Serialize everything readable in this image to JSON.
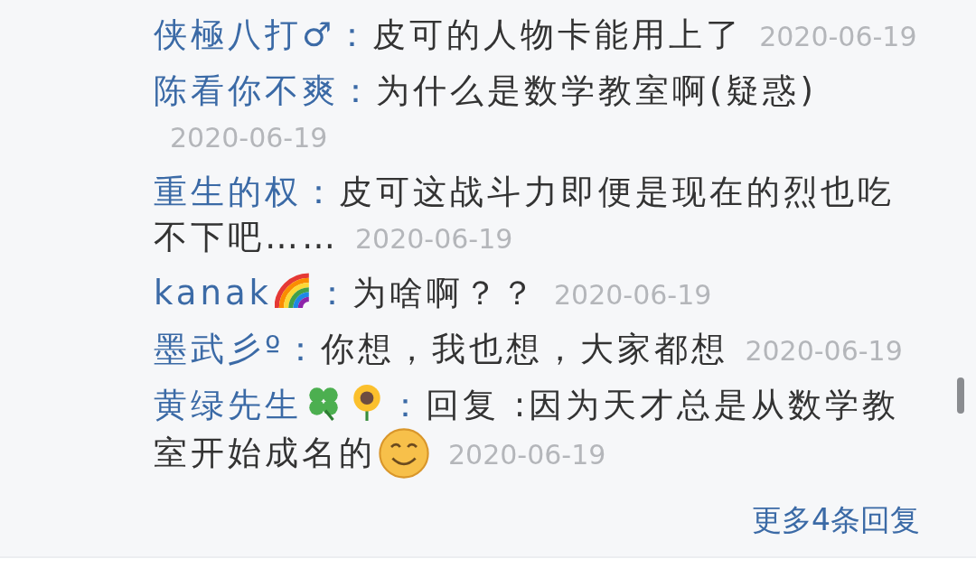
{
  "comments": [
    {
      "user": "侠極八打♂",
      "separator": "：",
      "content": "皮可的人物卡能用上了",
      "date": "2020-06-19"
    },
    {
      "user": "陈看你不爽",
      "separator": "：",
      "content": "为什么是数学教室啊(疑惑)",
      "date": "2020-06-19"
    },
    {
      "user": "重生的权",
      "separator": "：",
      "content": "皮可这战斗力即便是现在的烈也吃不下吧……",
      "date": "2020-06-19"
    },
    {
      "user": "kanak",
      "user_icons": [
        {
          "kind": "rainbow"
        }
      ],
      "separator": "：",
      "content": "为啥啊？？",
      "date": "2020-06-19"
    },
    {
      "user": "墨武彡º",
      "separator": "：",
      "content": "你想，我也想，大家都想",
      "date": "2020-06-19"
    },
    {
      "user": "黄绿先生",
      "user_icons": [
        {
          "kind": "clover"
        },
        {
          "kind": "sunflower"
        }
      ],
      "separator": "：",
      "content": "回复  :因为天才总是从数学教室开始成名的",
      "content_icons": [
        {
          "kind": "smiley"
        }
      ],
      "date": "2020-06-19"
    }
  ],
  "more_replies": "更多4条回复"
}
